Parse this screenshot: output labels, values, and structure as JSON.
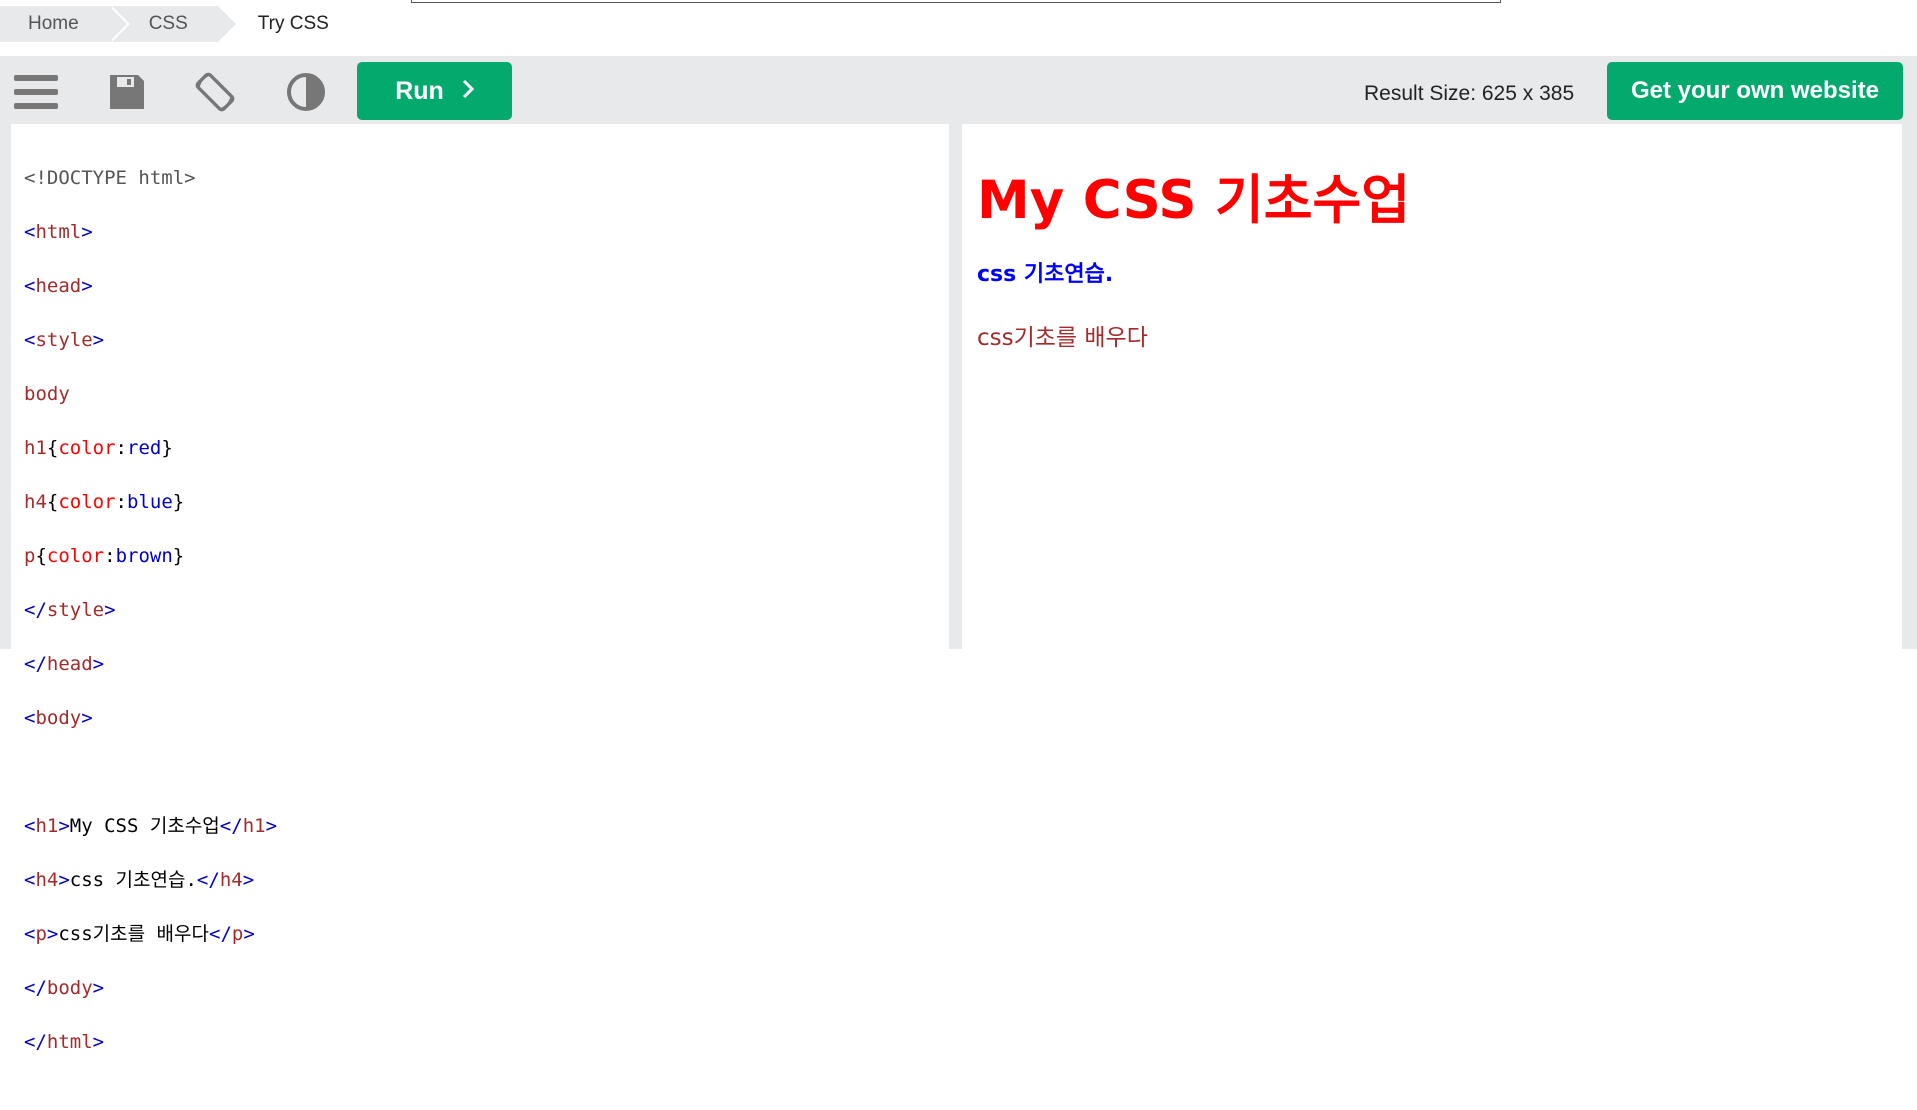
{
  "breadcrumb": {
    "items": [
      "Home",
      "CSS",
      "Try CSS"
    ]
  },
  "toolbar": {
    "icons": [
      "menu-icon",
      "save-icon",
      "rotate-icon",
      "contrast-icon"
    ],
    "run_label": "Run",
    "result_size": "Result Size: 625 x 385",
    "own_website_label": "Get your own website"
  },
  "editor": {
    "lines": [
      "<!DOCTYPE html>",
      "<html>",
      "<head>",
      "<style>",
      "body",
      "h1{color:red}",
      "h4{color:blue}",
      "p{color:brown}",
      "</style>",
      "</head>",
      "<body>",
      "",
      "<h1>My CSS 기초수업</h1>",
      "<h4>css 기초연습.</h4>",
      "<p>css기초를 배우다</p>",
      "</body>",
      "</html>"
    ]
  },
  "result": {
    "h1": "My CSS 기초수업",
    "h4": "css 기초연습.",
    "p": "css기초를 배우다"
  },
  "colors": {
    "accent": "#04aa6d",
    "toolbar_bg": "#e7e9eb"
  }
}
